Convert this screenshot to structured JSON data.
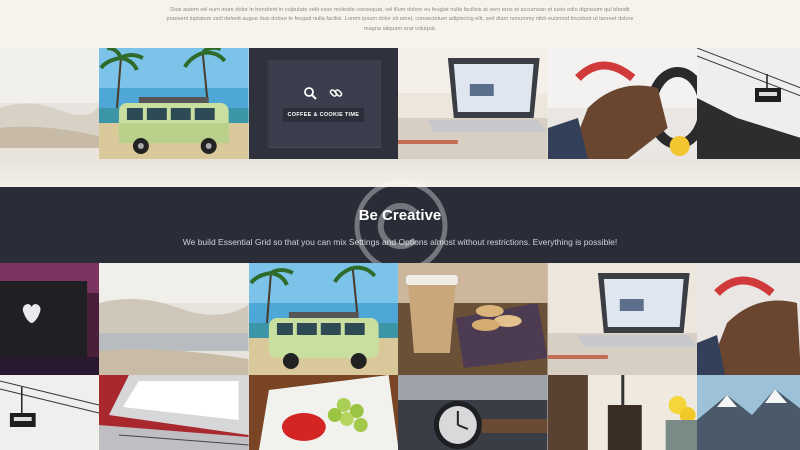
{
  "intro": {
    "text": "Duis autem vel eum iriure dolor in hendrerit in vulputate velit esse molestie consequat, vel illum dolore eu feugiat nulla facilisis at vero eros et accumsan et iusto odio dignissim qui blandit praesent luptatum zzril delenit augue duis dolore te feugait nulla facilisi. Lorem ipsum dolor sit amet, consectetuer adipiscing elit, sed diam nonummy nibh euismod tincidunt ut laoreet dolore magna aliquam erat volutpat."
  },
  "hover": {
    "label": "COFFEE & COOKIE TIME",
    "icons": [
      "search-icon",
      "link-icon"
    ]
  },
  "banner": {
    "title": "Be Creative",
    "subtitle": "We build Essential Grid so that you can mix Settings and Options almost without restrictions. Everything is possible!"
  },
  "colors": {
    "banner_bg": "#2a2d38",
    "page_bg": "#f6f2ea",
    "overlay": "#373c4b"
  }
}
